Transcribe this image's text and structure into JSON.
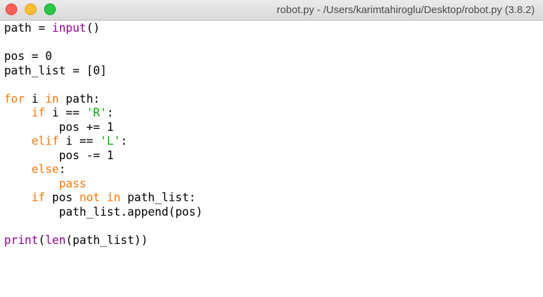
{
  "window": {
    "title": "robot.py - /Users/karimtahiroglu/Desktop/robot.py (3.8.2)",
    "buttons": {
      "close": "close",
      "minimize": "minimize",
      "zoom": "zoom"
    }
  },
  "colors": {
    "keyword": "#ff7700",
    "builtin": "#900090",
    "string": "#00aa00",
    "default": "#000000"
  },
  "code_lines": [
    [
      {
        "t": "path = ",
        "c": "plain"
      },
      {
        "t": "input",
        "c": "builtin"
      },
      {
        "t": "()",
        "c": "plain"
      }
    ],
    [],
    [
      {
        "t": "pos = 0",
        "c": "plain"
      }
    ],
    [
      {
        "t": "path_list = [0]",
        "c": "plain"
      }
    ],
    [],
    [
      {
        "t": "for",
        "c": "kw"
      },
      {
        "t": " i ",
        "c": "plain"
      },
      {
        "t": "in",
        "c": "kw"
      },
      {
        "t": " path:",
        "c": "plain"
      }
    ],
    [
      {
        "t": "    ",
        "c": "plain"
      },
      {
        "t": "if",
        "c": "kw"
      },
      {
        "t": " i == ",
        "c": "plain"
      },
      {
        "t": "'R'",
        "c": "str"
      },
      {
        "t": ":",
        "c": "plain"
      }
    ],
    [
      {
        "t": "        pos += 1",
        "c": "plain"
      }
    ],
    [
      {
        "t": "    ",
        "c": "plain"
      },
      {
        "t": "elif",
        "c": "kw"
      },
      {
        "t": " i == ",
        "c": "plain"
      },
      {
        "t": "'L'",
        "c": "str"
      },
      {
        "t": ":",
        "c": "plain"
      }
    ],
    [
      {
        "t": "        pos -= 1",
        "c": "plain"
      }
    ],
    [
      {
        "t": "    ",
        "c": "plain"
      },
      {
        "t": "else",
        "c": "kw"
      },
      {
        "t": ":",
        "c": "plain"
      }
    ],
    [
      {
        "t": "        ",
        "c": "plain"
      },
      {
        "t": "pass",
        "c": "kw"
      }
    ],
    [
      {
        "t": "    ",
        "c": "plain"
      },
      {
        "t": "if",
        "c": "kw"
      },
      {
        "t": " pos ",
        "c": "plain"
      },
      {
        "t": "not",
        "c": "kw"
      },
      {
        "t": " ",
        "c": "plain"
      },
      {
        "t": "in",
        "c": "kw"
      },
      {
        "t": " path_list:",
        "c": "plain"
      }
    ],
    [
      {
        "t": "        path_list.append(pos)",
        "c": "plain"
      }
    ],
    [],
    [
      {
        "t": "print",
        "c": "builtin"
      },
      {
        "t": "(",
        "c": "plain"
      },
      {
        "t": "len",
        "c": "builtin"
      },
      {
        "t": "(path_list))",
        "c": "plain"
      }
    ]
  ]
}
